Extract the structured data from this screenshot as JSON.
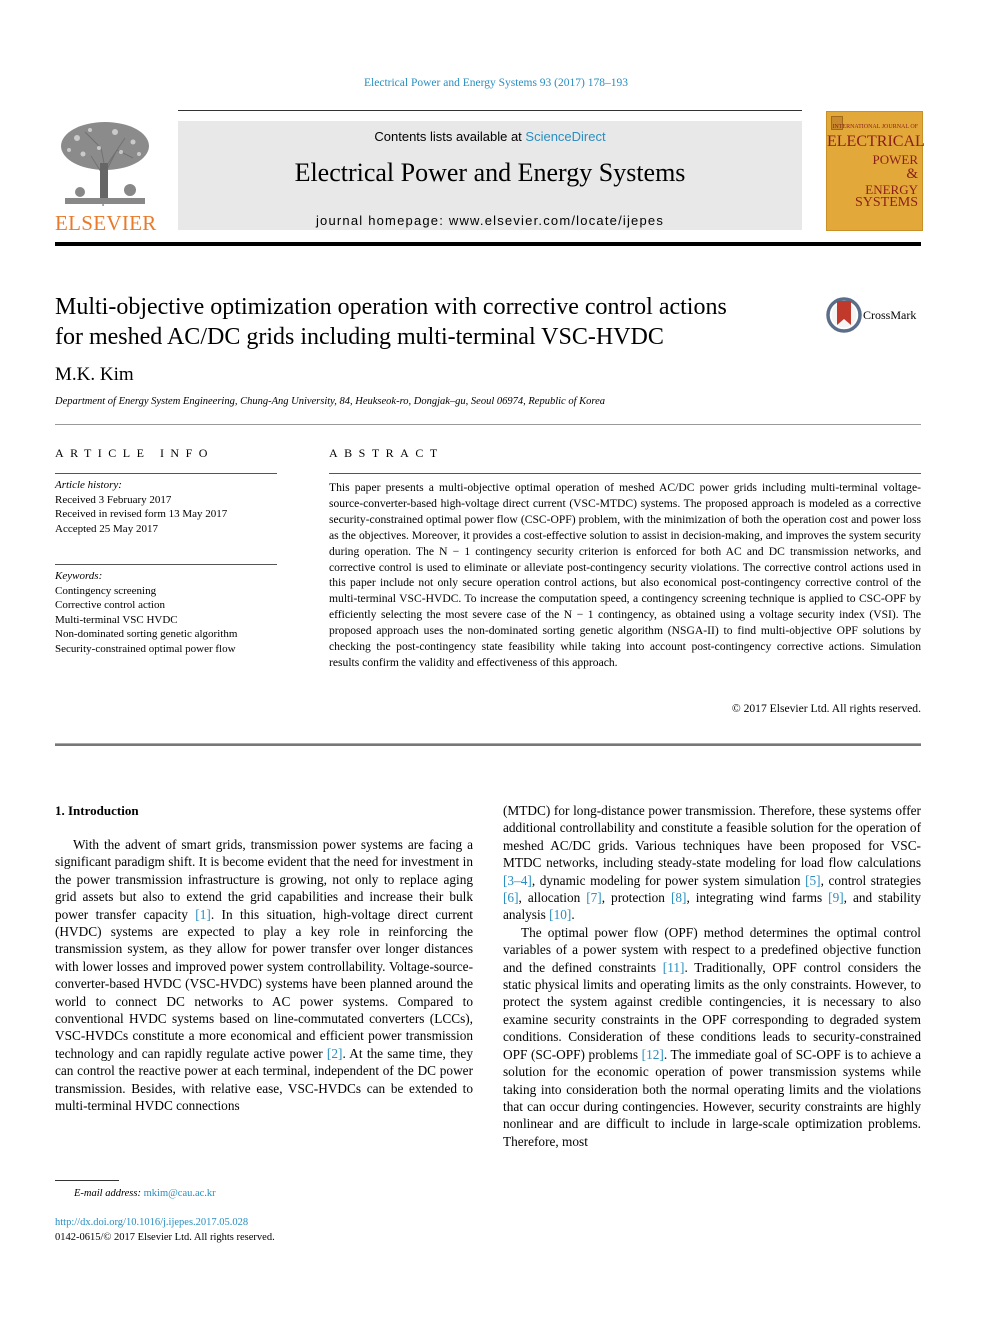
{
  "header": {
    "citation": "Electrical Power and Energy Systems 93 (2017) 178–193",
    "publisher_logo_text": "ELSEVIER",
    "contents_prefix": "Contents lists available at ",
    "contents_link": "ScienceDirect",
    "journal_title": "Electrical Power and Energy Systems",
    "homepage": "journal homepage: www.elsevier.com/locate/ijepes",
    "cover": {
      "line1": "INTERNATIONAL JOURNAL OF",
      "line2": "ELECTRICAL",
      "line3": "POWER",
      "line4": "&",
      "line5": "ENERGY",
      "line6": "SYSTEMS"
    },
    "colors": {
      "link": "#2a8ec0",
      "elsevier_orange": "#e87a2a",
      "cover_bg": "#e3a83a",
      "cover_text": "#8a1f1a"
    }
  },
  "article": {
    "title_line1": "Multi-objective optimization operation with corrective control actions",
    "title_line2": "for meshed AC/DC grids including multi-terminal VSC-HVDC",
    "crossmark": "CrossMark",
    "author": "M.K. Kim",
    "affiliation": "Department of Energy System Engineering, Chung-Ang University, 84, Heukseok-ro, Dongjak–gu, Seoul 06974, Republic of Korea"
  },
  "article_info": {
    "heading": "ARTICLE INFO",
    "history_label": "Article history:",
    "history": [
      "Received 3 February 2017",
      "Received in revised form 13 May 2017",
      "Accepted 25 May 2017"
    ],
    "keywords_label": "Keywords:",
    "keywords": [
      "Contingency screening",
      "Corrective control action",
      "Multi-terminal VSC HVDC",
      "Non-dominated sorting genetic algorithm",
      "Security-constrained optimal power flow"
    ]
  },
  "abstract": {
    "heading": "ABSTRACT",
    "text": "This paper presents a multi-objective optimal operation of meshed AC/DC power grids including multi-terminal voltage-source-converter-based high-voltage direct current (VSC-MTDC) systems. The proposed approach is modeled as a corrective security-constrained optimal power flow (CSC-OPF) problem, with the minimization of both the operation cost and power loss as the objectives. Moreover, it provides a cost-effective solution to assist in decision-making, and improves the system security during operation. The N − 1 contingency security criterion is enforced for both AC and DC transmission networks, and corrective control is used to eliminate or alleviate post-contingency security violations. The corrective control actions used in this paper include not only secure operation control actions, but also economical post-contingency corrective control of the multi-terminal VSC-HVDC. To increase the computation speed, a contingency screening technique is applied to CSC-OPF by efficiently selecting the most severe case of the N − 1 contingency, as obtained using a voltage security index (VSI). The proposed approach uses the non-dominated sorting genetic algorithm (NSGA-II) to find multi-objective OPF solutions by checking the post-contingency state feasibility while taking into account post-contingency corrective actions. Simulation results confirm the validity and effectiveness of this approach.",
    "copyright": "© 2017 Elsevier Ltd. All rights reserved."
  },
  "body": {
    "section_heading": "1. Introduction",
    "left_p1_a": "With the advent of smart grids, transmission power systems are facing a significant paradigm shift. It is become evident that the need for investment in the power transmission infrastructure is growing, not only to replace aging grid assets but also to extend the grid capabilities and increase their bulk power transfer capacity ",
    "ref1": "[1]",
    "left_p1_b": ". In this situation, high-voltage direct current (HVDC) systems are expected to play a key role in reinforcing the transmission system, as they allow for power transfer over longer distances with lower losses and improved power system controllability. Voltage-source-converter-based HVDC (VSC-HVDC) systems have been planned around the world to connect DC networks to AC power systems. Compared to conventional HVDC systems based on line-commutated converters (LCCs), VSC-HVDCs constitute a more economical and efficient power transmission technology and can rapidly regulate active power ",
    "ref2": "[2]",
    "left_p1_c": ". At the same time, they can control the reactive power at each terminal, independent of the DC power transmission. Besides, with relative ease, VSC-HVDCs can be extended to multi-terminal HVDC connections",
    "right_p1_a": "(MTDC) for long-distance power transmission. Therefore, these systems offer additional controllability and constitute a feasible solution for the operation of meshed AC/DC grids. Various techniques have been proposed for VSC-MTDC networks, including steady-state modeling for load flow calculations ",
    "ref3_4": "[3–4]",
    "right_p1_b": ", dynamic modeling for power system simulation ",
    "ref5": "[5]",
    "right_p1_c": ", control strategies ",
    "ref6": "[6]",
    "right_p1_d": ", allocation ",
    "ref7": "[7]",
    "right_p1_e": ", protection ",
    "ref8": "[8]",
    "right_p1_f": ", integrating wind farms ",
    "ref9": "[9]",
    "right_p1_g": ", and stability analysis ",
    "ref10": "[10]",
    "right_p1_h": ".",
    "right_p2_a": "The optimal power flow (OPF) method determines the optimal control variables of a power system with respect to a predefined objective function and the defined constraints ",
    "ref11": "[11]",
    "right_p2_b": ". Traditionally, OPF control considers the static physical limits and operating limits as the only constraints. However, to protect the system against credible contingencies, it is necessary to also examine security constraints in the OPF corresponding to degraded system conditions. Consideration of these conditions leads to security-constrained OPF (SC-OPF) problems ",
    "ref12": "[12]",
    "right_p2_c": ". The immediate goal of SC-OPF is to achieve a solution for the economic operation of power transmission systems while taking into consideration both the normal operating limits and the violations that can occur during contingencies. However, security constraints are highly nonlinear and are difficult to include in large-scale optimization problems. Therefore, most"
  },
  "footer": {
    "email_label": "E-mail address:",
    "email": "mkim@cau.ac.kr",
    "doi": "http://dx.doi.org/10.1016/j.ijepes.2017.05.028",
    "issn": "0142-0615/© 2017 Elsevier Ltd. All rights reserved."
  }
}
